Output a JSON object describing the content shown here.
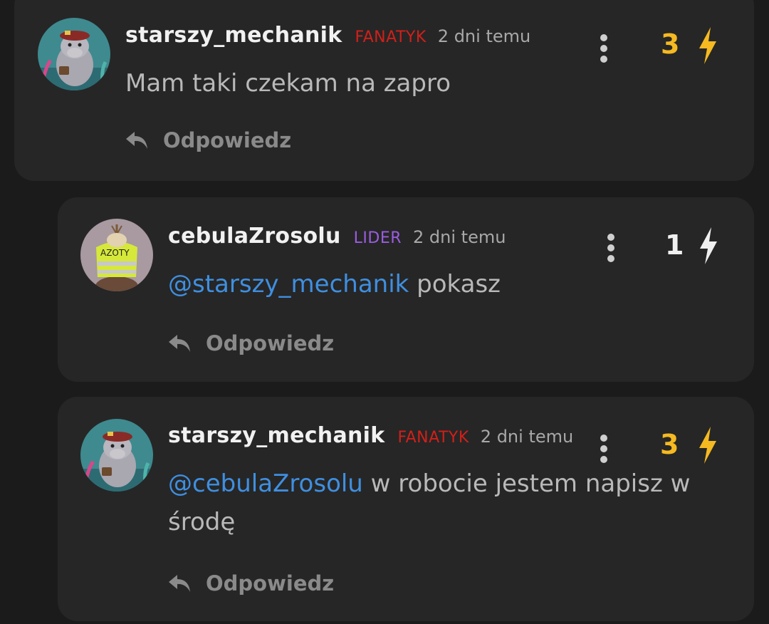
{
  "comments": [
    {
      "username": "starszy_mechanik",
      "rank": "FANATYK",
      "time": "2 dni temu",
      "score": "3",
      "text": "Mam taki czekam na zapro",
      "reply_label": "Odpowiedz"
    },
    {
      "username": "cebulaZrosolu",
      "rank": "LIDER",
      "time": "2 dni temu",
      "score": "1",
      "mention": "@starszy_mechanik",
      "text": " pokasz",
      "reply_label": "Odpowiedz",
      "avatar_text": "AZOTY"
    },
    {
      "username": "starszy_mechanik",
      "rank": "FANATYK",
      "time": "2 dni temu",
      "score": "3",
      "mention": "@cebulaZrosolu",
      "text": " w robocie jestem napisz w środę",
      "reply_label": "Odpowiedz"
    }
  ],
  "colors": {
    "background": "#1b1b1b",
    "card": "#262626",
    "rank_fanatyk": "#d0201a",
    "rank_lider": "#9a5de0",
    "mention": "#3f8fe0",
    "score_hot": "#f5b921",
    "score_neutral": "#f0f0f0"
  },
  "icons": {
    "menu": "vertical-dots-icon",
    "vote": "lightning-bolt-icon",
    "reply": "reply-arrow-icon"
  }
}
